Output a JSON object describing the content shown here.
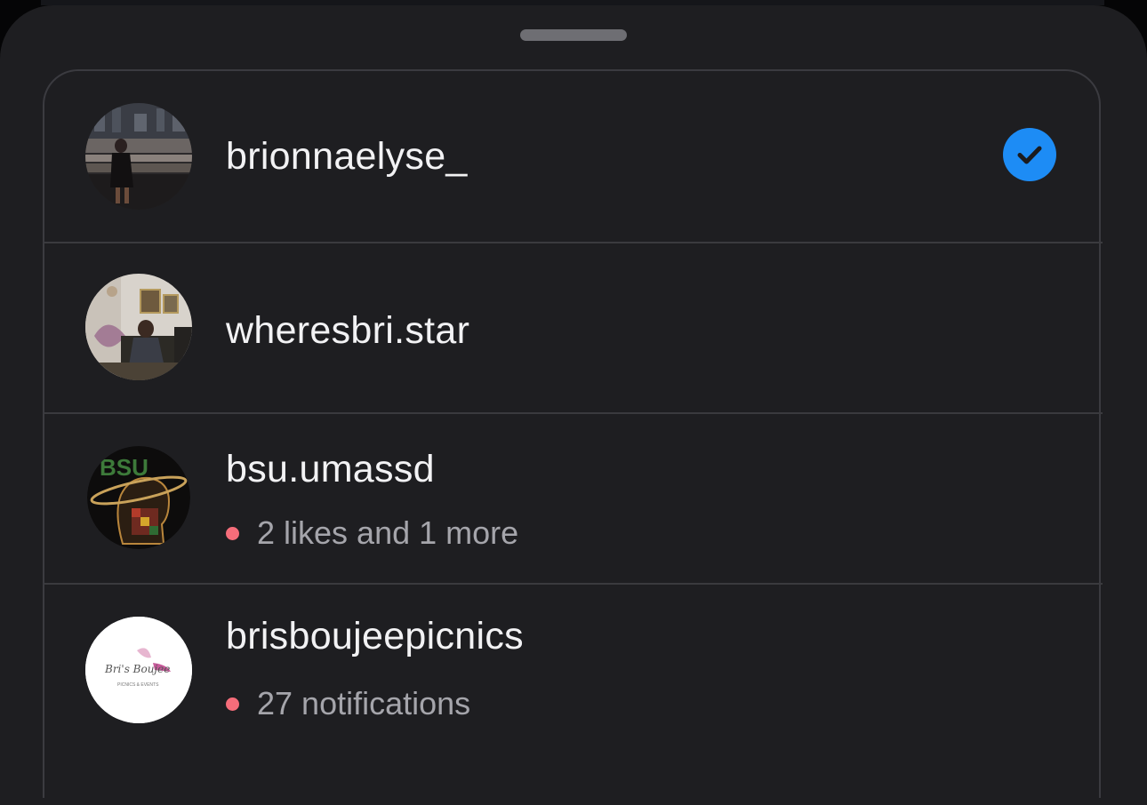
{
  "accounts": [
    {
      "username": "brionnaelyse_",
      "selected": true,
      "avatar": "photo-person-city-night"
    },
    {
      "username": "wheresbri.star",
      "selected": false,
      "avatar": "photo-person-seated-room"
    },
    {
      "username": "bsu.umassd",
      "selected": false,
      "status": "2 likes and 1 more",
      "avatar": "bsu-logo",
      "avatar_text": "BSU"
    },
    {
      "username": "brisboujeepicnics",
      "selected": false,
      "status": "27 notifications",
      "avatar": "brand-logo",
      "avatar_text": "Bri's Boujee",
      "avatar_subtext": "PICNICS & EVENTS"
    }
  ],
  "colors": {
    "sheet": "#1e1e21",
    "accent_blue": "#1d8cf5",
    "notification_dot": "#f56d7a"
  }
}
